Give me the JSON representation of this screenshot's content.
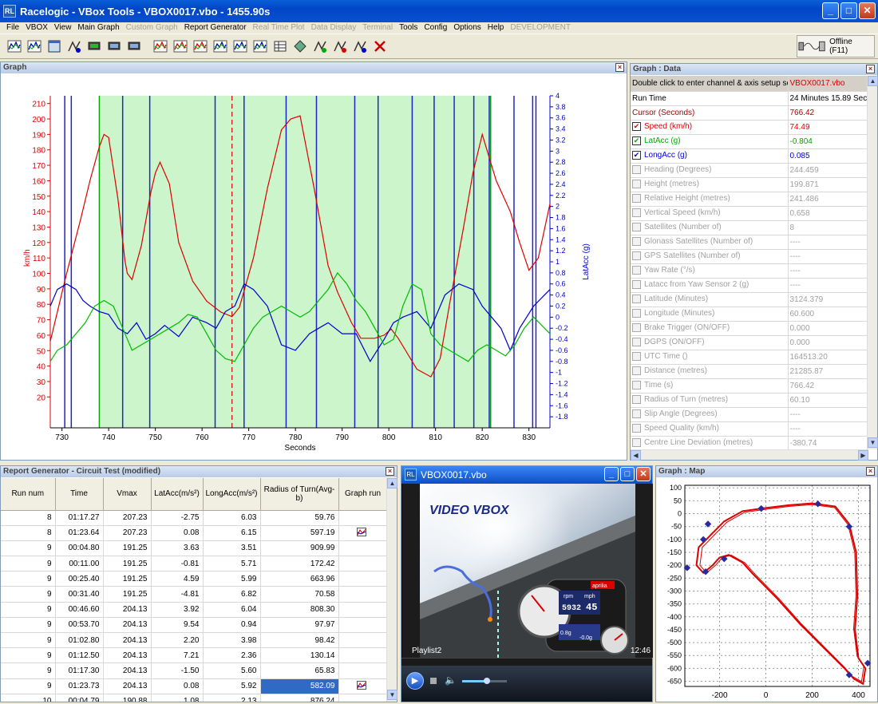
{
  "window": {
    "title": "Racelogic - VBox Tools - VBOX0017.vbo - 1455.90s"
  },
  "menu": [
    {
      "label": "File",
      "enabled": true
    },
    {
      "label": "VBOX",
      "enabled": true
    },
    {
      "label": "View",
      "enabled": true
    },
    {
      "label": "Main Graph",
      "enabled": true
    },
    {
      "label": "Custom Graph",
      "enabled": false
    },
    {
      "label": "Report Generator",
      "enabled": true
    },
    {
      "label": "Real Time Plot",
      "enabled": false
    },
    {
      "label": "Data Display",
      "enabled": false
    },
    {
      "label": "Terminal",
      "enabled": false
    },
    {
      "label": "Tools",
      "enabled": true
    },
    {
      "label": "Config",
      "enabled": true
    },
    {
      "label": "Options",
      "enabled": true
    },
    {
      "label": "Help",
      "enabled": true
    },
    {
      "label": "DEVELOPMENT",
      "enabled": false
    }
  ],
  "toolbar": {
    "offline_label": "Offline (F11)"
  },
  "graph": {
    "title": "Graph",
    "xlabel": "Seconds",
    "ylabel_left": "km/h",
    "ylabel_right": "LatAcc (g)"
  },
  "chart_data": {
    "type": "line",
    "title": "",
    "xlabel": "Seconds",
    "ylabel": "km/h",
    "y2label": "LatAcc (g)",
    "xlim": [
      727.5,
      834.5
    ],
    "ylim": [
      0,
      215
    ],
    "y2lim": [
      -2,
      4
    ],
    "xticks": [
      730,
      740,
      750,
      760,
      770,
      780,
      790,
      800,
      810,
      820,
      830
    ],
    "yticks": [
      20,
      30,
      40,
      50,
      60,
      70,
      80,
      90,
      100,
      110,
      120,
      130,
      140,
      150,
      160,
      170,
      180,
      190,
      200,
      210
    ],
    "y2ticks": [
      -1.8,
      -1.6,
      -1.4,
      -1.2,
      -1,
      -0.8,
      -0.6,
      -0.4,
      -0.2,
      0,
      0.2,
      0.4,
      0.6,
      0.8,
      1,
      1.2,
      1.4,
      1.6,
      1.8,
      2,
      2.2,
      2.4,
      2.6,
      2.8,
      3,
      3.2,
      3.4,
      3.6,
      3.8,
      4
    ],
    "grid": false,
    "shaded_region": [
      738,
      821.8
    ],
    "cursor_x": 766.42,
    "vertical_markers": [
      730.6,
      732,
      743,
      748.8,
      762.8,
      769,
      778,
      784.5,
      792.7,
      797.7,
      805,
      809.7,
      814,
      818.2,
      821.5,
      826.8,
      830.8,
      831.5
    ],
    "series": [
      {
        "name": "Speed (km/h)",
        "color": "#dd0000",
        "axis": "left",
        "x": [
          727.5,
          731,
          734,
          736,
          738,
          739,
          740,
          742,
          743.5,
          744,
          745,
          747,
          749,
          750,
          751,
          753,
          755,
          758,
          761,
          764,
          766.4,
          768,
          771,
          774,
          777,
          779,
          781,
          784,
          787,
          789,
          792,
          794,
          797,
          799,
          800.5,
          802,
          806,
          809,
          811,
          813,
          816,
          818,
          820,
          821,
          823,
          826,
          828,
          830,
          832,
          834.5
        ],
        "y": [
          56,
          100,
          135,
          160,
          182,
          190,
          188,
          148,
          108,
          100,
          96,
          118,
          152,
          165,
          172,
          158,
          120,
          95,
          82,
          75,
          72,
          78,
          110,
          155,
          193,
          200,
          202,
          155,
          105,
          88,
          68,
          58,
          58,
          60,
          64,
          58,
          38,
          33,
          45,
          80,
          130,
          165,
          190,
          180,
          160,
          140,
          120,
          102,
          110,
          145
        ]
      },
      {
        "name": "LatAcc (g)",
        "color": "#0000cc",
        "axis": "right",
        "x": [
          727.5,
          729,
          731,
          733,
          734.5,
          736,
          738,
          740,
          742,
          744,
          746,
          748,
          750,
          752,
          755,
          758,
          761,
          763,
          765,
          767,
          769,
          771,
          774,
          777,
          780,
          783,
          785,
          787,
          790,
          793,
          796,
          799,
          801,
          803,
          806,
          809,
          812,
          815,
          818,
          820,
          822,
          824,
          826,
          828,
          831,
          834.5
        ],
        "y": [
          0.2,
          0.5,
          0.6,
          0.5,
          0.3,
          0.2,
          0.1,
          0.05,
          -0.2,
          -0.3,
          -0.1,
          -0.4,
          -0.3,
          -0.15,
          -0.35,
          0.0,
          -0.1,
          -0.2,
          0.1,
          0.2,
          0.6,
          0.5,
          0.2,
          -0.5,
          -0.6,
          -0.3,
          -0.2,
          -0.1,
          -0.3,
          -0.3,
          -0.8,
          -0.4,
          -0.1,
          0.0,
          0.1,
          -0.2,
          0.4,
          0.6,
          0.5,
          0.2,
          0.0,
          -0.2,
          -0.6,
          -0.2,
          0.2,
          0.5
        ]
      },
      {
        "name": "LongAcc (g)",
        "color": "#00bb00",
        "axis": "right",
        "x": [
          727.5,
          729,
          731,
          733,
          735,
          737,
          739,
          741,
          743,
          745,
          747,
          749,
          751,
          753,
          755,
          757,
          759,
          761,
          763,
          765,
          767,
          769,
          771,
          773,
          775,
          777,
          779,
          781,
          783,
          785,
          787,
          789,
          791,
          793,
          795,
          797,
          799,
          801,
          803,
          805,
          807,
          809,
          811,
          813,
          815,
          817,
          819,
          821,
          823,
          825,
          827,
          829,
          831,
          834.5
        ],
        "y": [
          -0.8,
          -0.6,
          -0.5,
          -0.3,
          -0.1,
          0.2,
          0.3,
          0.2,
          -0.2,
          -0.6,
          -0.5,
          -0.4,
          -0.3,
          -0.2,
          -0.1,
          0.05,
          0.0,
          -0.3,
          -0.6,
          -0.75,
          -0.8,
          -0.5,
          -0.2,
          0.0,
          0.1,
          0.2,
          0.1,
          0.0,
          0.1,
          0.3,
          0.5,
          0.8,
          0.6,
          0.3,
          0.1,
          -0.2,
          -0.5,
          -0.4,
          0.2,
          0.6,
          0.5,
          -0.3,
          -0.5,
          -0.6,
          -0.7,
          -0.8,
          -0.6,
          -0.5,
          -0.6,
          -0.7,
          -0.5,
          -0.2,
          0.0,
          -0.3
        ]
      }
    ]
  },
  "data_panel": {
    "title": "Graph : Data",
    "header_label": "Double click to enter channel & axis setup scre",
    "header_value": "VBOX0017.vbo",
    "rows": [
      {
        "label": "Run Time",
        "value": "24 Minutes 15.89 Seco",
        "checkbox": false,
        "color": "#000000",
        "enabled": true
      },
      {
        "label": "Cursor (Seconds)",
        "value": "766.42",
        "checkbox": false,
        "color": "#aa0000",
        "enabled": true
      },
      {
        "label": "Speed (km/h)",
        "value": "74.49",
        "checkbox": true,
        "checked": true,
        "color": "#dd0000",
        "enabled": true
      },
      {
        "label": "LatAcc (g)",
        "value": "-0.804",
        "checkbox": true,
        "checked": true,
        "color": "#00aa00",
        "enabled": true
      },
      {
        "label": "LongAcc (g)",
        "value": "0.085",
        "checkbox": true,
        "checked": true,
        "color": "#0000dd",
        "enabled": true
      },
      {
        "label": "Heading (Degrees)",
        "value": "244.459",
        "checkbox": true,
        "checked": false,
        "enabled": false
      },
      {
        "label": "Height (metres)",
        "value": "199.871",
        "checkbox": true,
        "checked": false,
        "enabled": false
      },
      {
        "label": "Relative Height (metres)",
        "value": "241.486",
        "checkbox": true,
        "checked": false,
        "enabled": false
      },
      {
        "label": "Vertical Speed (km/h)",
        "value": "0.658",
        "checkbox": true,
        "checked": false,
        "enabled": false
      },
      {
        "label": "Satellites (Number of)",
        "value": "8",
        "checkbox": true,
        "checked": false,
        "enabled": false
      },
      {
        "label": "Glonass Satellites (Number of)",
        "value": "----",
        "checkbox": true,
        "checked": false,
        "enabled": false
      },
      {
        "label": "GPS Satellites (Number of)",
        "value": "----",
        "checkbox": true,
        "checked": false,
        "enabled": false
      },
      {
        "label": "Yaw Rate (°/s)",
        "value": "----",
        "checkbox": true,
        "checked": false,
        "enabled": false
      },
      {
        "label": "Latacc from Yaw Sensor 2 (g)",
        "value": "----",
        "checkbox": true,
        "checked": false,
        "enabled": false
      },
      {
        "label": "Latitude (Minutes)",
        "value": "3124.379",
        "checkbox": true,
        "checked": false,
        "enabled": false
      },
      {
        "label": "Longitude (Minutes)",
        "value": "60.600",
        "checkbox": true,
        "checked": false,
        "enabled": false
      },
      {
        "label": "Brake Trigger (ON/OFF)",
        "value": "0.000",
        "checkbox": true,
        "checked": false,
        "enabled": false
      },
      {
        "label": "DGPS (ON/OFF)",
        "value": "0.000",
        "checkbox": true,
        "checked": false,
        "enabled": false
      },
      {
        "label": "UTC Time ()",
        "value": "164513.20",
        "checkbox": true,
        "checked": false,
        "enabled": false
      },
      {
        "label": "Distance (metres)",
        "value": "21285.87",
        "checkbox": true,
        "checked": false,
        "enabled": false
      },
      {
        "label": "Time (s)",
        "value": "766.42",
        "checkbox": true,
        "checked": false,
        "enabled": false
      },
      {
        "label": "Radius of Turn (metres)",
        "value": "60.10",
        "checkbox": true,
        "checked": false,
        "enabled": false
      },
      {
        "label": "Slip Angle (Degrees)",
        "value": "----",
        "checkbox": true,
        "checked": false,
        "enabled": false
      },
      {
        "label": "Speed Quality (km/h)",
        "value": "----",
        "checkbox": true,
        "checked": false,
        "enabled": false
      },
      {
        "label": "Centre Line Deviation (metres)",
        "value": "-380.74",
        "checkbox": true,
        "checked": false,
        "enabled": false
      }
    ]
  },
  "report": {
    "title": "Report Generator - Circuit Test (modified)",
    "columns": [
      "Run num",
      "Time",
      "Vmax",
      "LatAcc(m/s²)",
      "LongAcc(m/s²)",
      "Radius of Turn(Avg-b)",
      "Graph run"
    ],
    "rows": [
      [
        "8",
        "01:17.27",
        "207.23",
        "-2.75",
        "6.03",
        "59.76",
        ""
      ],
      [
        "8",
        "01:23.64",
        "207.23",
        "0.08",
        "6.15",
        "597.19",
        "graph"
      ],
      [
        "9",
        "00:04.80",
        "191.25",
        "3.63",
        "3.51",
        "909.99",
        ""
      ],
      [
        "9",
        "00:11.00",
        "191.25",
        "-0.81",
        "5.71",
        "172.42",
        ""
      ],
      [
        "9",
        "00:25.40",
        "191.25",
        "4.59",
        "5.99",
        "663.96",
        ""
      ],
      [
        "9",
        "00:31.40",
        "191.25",
        "-4.81",
        "6.82",
        "70.58",
        ""
      ],
      [
        "9",
        "00:46.60",
        "204.13",
        "3.92",
        "6.04",
        "808.30",
        ""
      ],
      [
        "9",
        "00:53.70",
        "204.13",
        "9.54",
        "0.94",
        "97.97",
        ""
      ],
      [
        "9",
        "01:02.80",
        "204.13",
        "2.20",
        "3.98",
        "98.42",
        ""
      ],
      [
        "9",
        "01:12.50",
        "204.13",
        "7.21",
        "2.36",
        "130.14",
        ""
      ],
      [
        "9",
        "01:17.30",
        "204.13",
        "-1.50",
        "5.60",
        "65.83",
        ""
      ],
      [
        "9",
        "01:23.73",
        "204.13",
        "0.08",
        "5.92",
        "582.09",
        "graph"
      ],
      [
        "10",
        "00:04.79",
        "190.88",
        "1.08",
        "2.13",
        "876.24",
        ""
      ]
    ],
    "selected_cell": [
      11,
      5
    ]
  },
  "video": {
    "title": "VBOX0017.vbo",
    "brand": "VIDEO VBOX",
    "playlist": "Playlist2",
    "time": "12:46",
    "rpm_label": "rpm",
    "mph_label": "mph",
    "rpm_value": "5932",
    "mph_value": "45",
    "sponsor": "aprilia",
    "lat_g": "0.8g",
    "long_g": "-0.0g",
    "progress": 0.0,
    "volume": 0.55
  },
  "map": {
    "title": "Graph : Map",
    "xticks": [
      "-200",
      "0",
      "200",
      "400"
    ],
    "yticks": [
      "100",
      "50",
      "0",
      "-50",
      "-100",
      "-150",
      "-200",
      "-250",
      "-300",
      "-350",
      "-400",
      "-450",
      "-500",
      "-550",
      "-600",
      "-650"
    ],
    "xlim": [
      -350,
      450
    ],
    "ylim": [
      -670,
      110
    ],
    "color": "#dd0000",
    "track": [
      [
        0,
        22
      ],
      [
        100,
        33
      ],
      [
        200,
        40
      ],
      [
        300,
        28
      ],
      [
        360,
        -40
      ],
      [
        390,
        -150
      ],
      [
        395,
        -320
      ],
      [
        385,
        -450
      ],
      [
        400,
        -560
      ],
      [
        430,
        -600
      ],
      [
        420,
        -660
      ],
      [
        380,
        -640
      ],
      [
        340,
        -600
      ],
      [
        250,
        -520
      ],
      [
        150,
        -430
      ],
      [
        50,
        -330
      ],
      [
        -60,
        -230
      ],
      [
        -100,
        -190
      ],
      [
        -160,
        -160
      ],
      [
        -200,
        -170
      ],
      [
        -230,
        -200
      ],
      [
        -270,
        -230
      ],
      [
        -300,
        -200
      ],
      [
        -290,
        -130
      ],
      [
        -230,
        -75
      ],
      [
        -180,
        -30
      ],
      [
        -100,
        10
      ],
      [
        0,
        22
      ]
    ],
    "markers": [
      [
        -20,
        20
      ],
      [
        225,
        38
      ],
      [
        360,
        -50
      ],
      [
        -250,
        -40
      ],
      [
        -270,
        -100
      ],
      [
        -180,
        -175
      ],
      [
        -340,
        -210
      ],
      [
        -260,
        -225
      ],
      [
        360,
        -625
      ],
      [
        440,
        -580
      ]
    ]
  }
}
